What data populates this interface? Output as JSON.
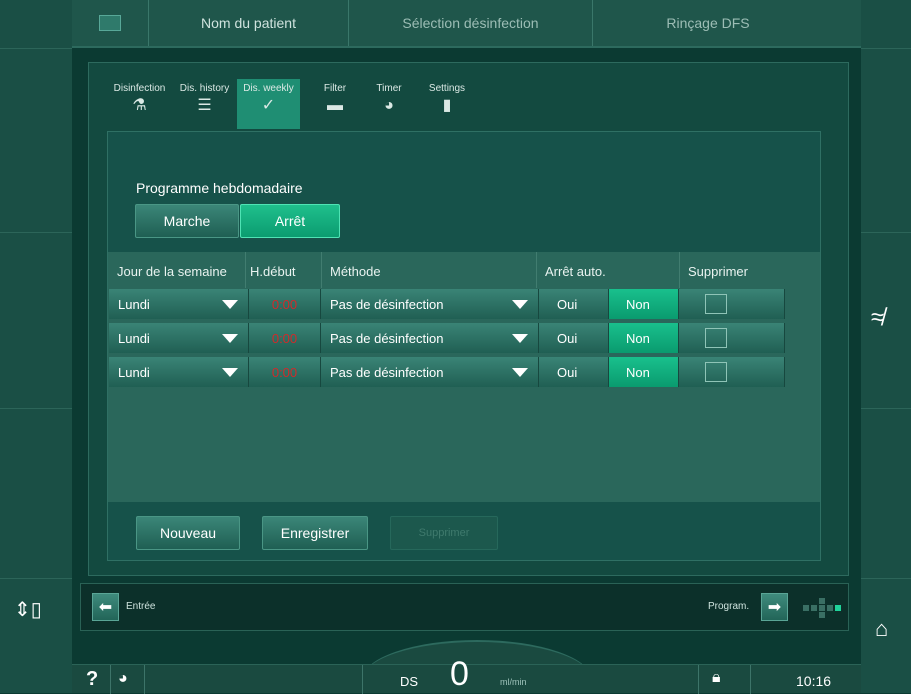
{
  "top_tabs": [
    "",
    "Nom du patient",
    "Sélection désinfection",
    "Rinçage DFS"
  ],
  "subtabs": [
    {
      "label": "Disinfection",
      "icon": "disinfection-icon",
      "glyph": "⚗"
    },
    {
      "label": "Dis. history",
      "icon": "history-icon",
      "glyph": "☰"
    },
    {
      "label": "Dis. weekly",
      "icon": "weekly-icon",
      "glyph": "✓"
    },
    {
      "label": "Filter",
      "icon": "filter-icon",
      "glyph": "▬"
    },
    {
      "label": "Timer",
      "icon": "timer-icon",
      "glyph": "◕"
    },
    {
      "label": "Settings",
      "icon": "settings-icon",
      "glyph": "▮"
    }
  ],
  "weekly": {
    "title": "Programme hebdomadaire",
    "on_label": "Marche",
    "off_label": "Arrêt",
    "selected": "Arrêt"
  },
  "table": {
    "headers": [
      "Jour de la semaine",
      "H.début",
      "Méthode",
      "Arrêt auto.",
      "Supprimer"
    ],
    "rows": [
      {
        "day": "Lundi",
        "start": "0:00",
        "method": "Pas de désinfection",
        "yes": "Oui",
        "no": "Non"
      },
      {
        "day": "Lundi",
        "start": "0:00",
        "method": "Pas de désinfection",
        "yes": "Oui",
        "no": "Non"
      },
      {
        "day": "Lundi",
        "start": "0:00",
        "method": "Pas de désinfection",
        "yes": "Oui",
        "no": "Non"
      }
    ]
  },
  "actions": {
    "new": "Nouveau",
    "save": "Enregistrer",
    "delete": "Supprimer"
  },
  "nav": {
    "back": "Entrée",
    "forward": "Program."
  },
  "status": {
    "ds": "DS",
    "flow": "0",
    "unit": "ml/min",
    "time": "10:16"
  },
  "colors": {
    "accent": "#1fbf8c",
    "panel": "#134a40",
    "error": "#d12a2a"
  }
}
